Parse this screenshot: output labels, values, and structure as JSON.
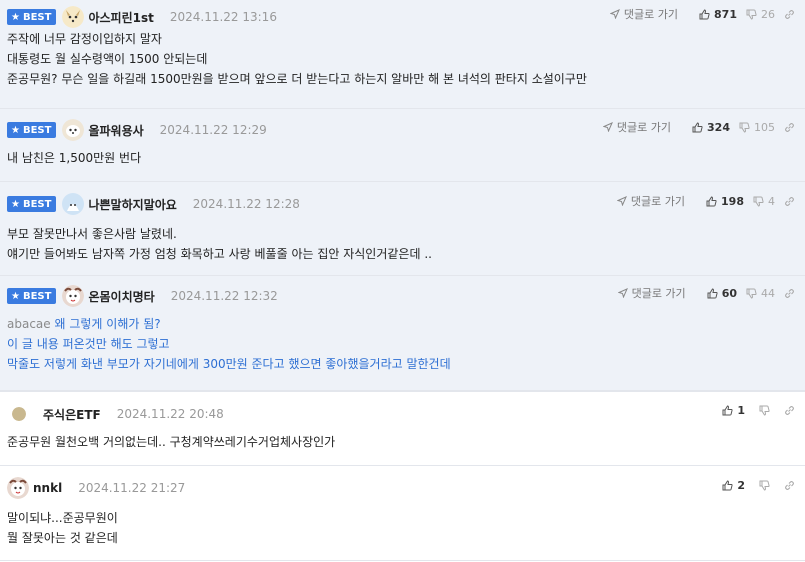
{
  "comments": [
    {
      "best": true,
      "badge": "BEST",
      "nick": "아스피린1st",
      "date": "2024.11.22 13:16",
      "reply_label": "댓글로 가기",
      "likes": "871",
      "dislikes": "26",
      "lines": [
        "주작에 너무 감정이입하지 말자",
        "대통령도 월 실수령액이 1500 안되는데",
        "준공무원? 무슨 일을 하길래 1500만원을 받으며 앞으로 더 받는다고 하는지 알바만 해 본 녀석의 판타지 소설이구만"
      ]
    },
    {
      "best": true,
      "badge": "BEST",
      "nick": "올파워용사",
      "date": "2024.11.22 12:29",
      "reply_label": "댓글로 가기",
      "likes": "324",
      "dislikes": "105",
      "lines": [
        "내 남친은 1,500만원 번다"
      ]
    },
    {
      "best": true,
      "badge": "BEST",
      "nick": "나쁜말하지말아요",
      "date": "2024.11.22 12:28",
      "reply_label": "댓글로 가기",
      "likes": "198",
      "dislikes": "4",
      "lines": [
        "부모 잘못만나서 좋은사람 날렸네.",
        "얘기만 들어봐도 남자쪽 가정 엄청 화목하고 사랑 베풀줄 아는 집안 자식인거같은데 .."
      ]
    },
    {
      "best": true,
      "badge": "BEST",
      "nick": "온몸이치명타",
      "date": "2024.11.22 12:32",
      "reply_label": "댓글로 가기",
      "likes": "60",
      "dislikes": "44",
      "mention": "abacae",
      "lines": [
        "왜 그렇게 이해가 됨?",
        "이 글 내용 퍼온것만 해도 그렇고",
        "막줄도 저렇게 화낸 부모가 자기네에게 300만원 준다고 했으면 좋아했을거라고 말한건데"
      ]
    },
    {
      "best": false,
      "nick": "주식은ETF",
      "date": "2024.11.22 20:48",
      "likes": "1",
      "lines": [
        "준공무원 월천오백 거의없는데.. 구청계약쓰레기수거업체사장인가"
      ]
    },
    {
      "best": false,
      "nick": "nnkl",
      "date": "2024.11.22 21:27",
      "likes": "2",
      "lines": [
        "말이되냐...준공무원이",
        "뭘 잘못아는 것 같은데"
      ]
    }
  ],
  "colors": {
    "best_bg": "#eef2f8",
    "badge_bg": "#3a7be0",
    "blue_text": "#2d6fd3",
    "mention": "#8a8a8a",
    "date": "#999999"
  },
  "icons": {
    "badge": "star-icon",
    "reply": "paper-plane-icon",
    "like": "thumbs-up-icon",
    "dislike": "thumbs-down-icon",
    "link": "link-icon"
  }
}
